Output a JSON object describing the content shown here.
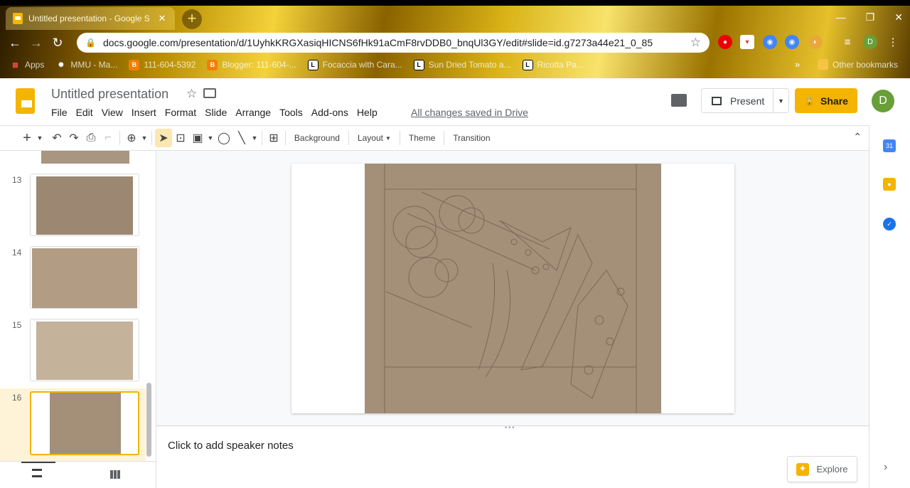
{
  "browser": {
    "tab_title": "Untitled presentation - Google S",
    "tab_close": "✕",
    "new_tab": "+",
    "url": "docs.google.com/presentation/d/1UyhkKRGXasiqHICNS6fHk91aCmF8rvDDB0_bnqUl3GY/edit#slide=id.g7273a44e21_0_85",
    "profile_initial": "D",
    "bookmarks": [
      {
        "label": "Apps",
        "color": "#e8453c",
        "glyph": "▦"
      },
      {
        "label": "MMU - Ma...",
        "color": "#ffffff",
        "glyph": "✺"
      },
      {
        "label": "111-604-5392",
        "color": "#f57d00",
        "glyph": "B"
      },
      {
        "label": "Blogger: 111-604-...",
        "color": "#f57d00",
        "glyph": "B"
      },
      {
        "label": "Focaccia with Cara...",
        "color": "#ffffff",
        "glyph": "L"
      },
      {
        "label": "Sun Dried Tomato a...",
        "color": "#ffffff",
        "glyph": "L"
      },
      {
        "label": "Ricotta Pa...",
        "color": "#ffffff",
        "glyph": "L"
      }
    ],
    "bookmarks_more": "»",
    "other_bookmarks": "Other bookmarks"
  },
  "doc": {
    "title": "Untitled presentation",
    "menu": [
      "File",
      "Edit",
      "View",
      "Insert",
      "Format",
      "Slide",
      "Arrange",
      "Tools",
      "Add-ons",
      "Help"
    ],
    "save_status": "All changes saved in Drive",
    "present_label": "Present",
    "share_label": "Share",
    "avatar_initial": "D"
  },
  "toolbar": {
    "background": "Background",
    "layout": "Layout",
    "theme": "Theme",
    "transition": "Transition"
  },
  "filmstrip": {
    "slides": [
      {
        "num": "13",
        "thumb_color": "#9c8872"
      },
      {
        "num": "14",
        "thumb_color": "#b29c84"
      },
      {
        "num": "15",
        "thumb_color": "#c4b29a"
      },
      {
        "num": "16",
        "thumb_color": "#a48f79"
      }
    ],
    "selected": "16"
  },
  "notes": {
    "placeholder": "Click to add speaker notes"
  },
  "explore": {
    "label": "Explore"
  },
  "side_panel": {
    "calendar_label": "31"
  }
}
